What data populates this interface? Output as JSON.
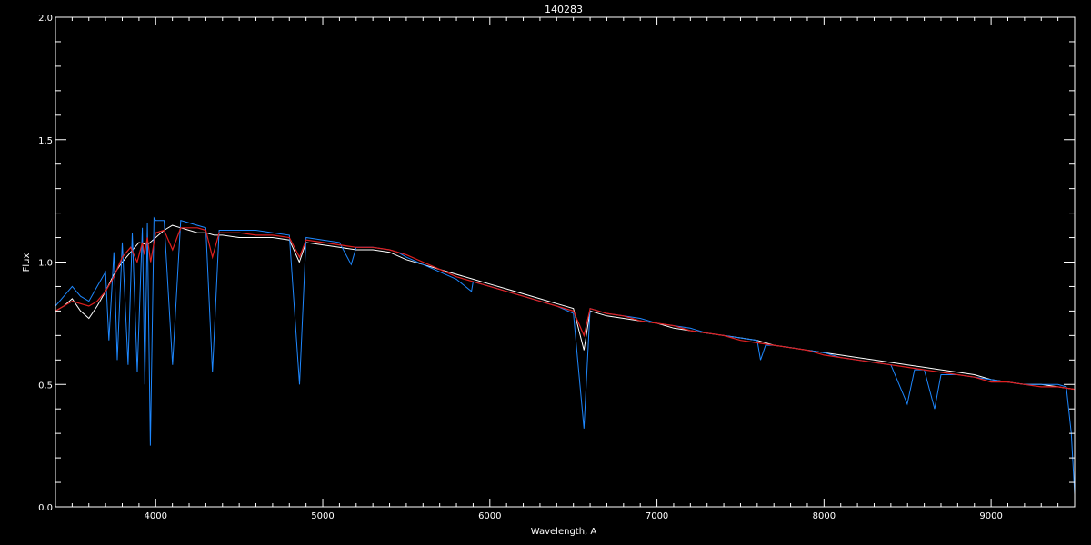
{
  "chart_data": {
    "type": "line",
    "title": "140283",
    "xlabel": "Wavelength, A",
    "ylabel": "Flux",
    "xlim": [
      3400,
      9500
    ],
    "ylim": [
      0.0,
      2.0
    ],
    "x_ticks": [
      4000,
      5000,
      6000,
      7000,
      8000,
      9000
    ],
    "x_tick_labels": [
      "4000",
      "5000",
      "6000",
      "7000",
      "8000",
      "9000"
    ],
    "y_ticks": [
      0.0,
      0.5,
      1.0,
      1.5,
      2.0
    ],
    "y_tick_labels": [
      "0.0",
      "0.5",
      "1.0",
      "1.5",
      "2.0"
    ],
    "grid": false,
    "background": "#000000",
    "axis_color": "#ffffff",
    "series": [
      {
        "color": "#ffffff",
        "x": [
          3400,
          3450,
          3500,
          3550,
          3600,
          3650,
          3700,
          3750,
          3800,
          3850,
          3900,
          3950,
          4000,
          4050,
          4100,
          4150,
          4200,
          4250,
          4300,
          4350,
          4400,
          4500,
          4600,
          4700,
          4800,
          4860,
          4900,
          5000,
          5100,
          5200,
          5300,
          5400,
          5500,
          5600,
          5700,
          5800,
          5900,
          6000,
          6100,
          6200,
          6300,
          6400,
          6500,
          6563,
          6600,
          6700,
          6800,
          6900,
          7000,
          7100,
          7200,
          7300,
          7400,
          7500,
          7600,
          7700,
          7800,
          7900,
          8000,
          8100,
          8200,
          8300,
          8400,
          8500,
          8600,
          8700,
          8800,
          8900,
          9000,
          9100,
          9200,
          9300,
          9400,
          9500
        ],
        "y": [
          0.8,
          0.82,
          0.85,
          0.8,
          0.77,
          0.82,
          0.88,
          0.95,
          1.0,
          1.04,
          1.08,
          1.07,
          1.1,
          1.13,
          1.15,
          1.14,
          1.13,
          1.12,
          1.12,
          1.11,
          1.11,
          1.1,
          1.1,
          1.1,
          1.09,
          1.0,
          1.08,
          1.07,
          1.06,
          1.05,
          1.05,
          1.04,
          1.01,
          0.99,
          0.97,
          0.95,
          0.93,
          0.91,
          0.89,
          0.87,
          0.85,
          0.83,
          0.81,
          0.64,
          0.8,
          0.78,
          0.77,
          0.76,
          0.75,
          0.73,
          0.72,
          0.71,
          0.7,
          0.69,
          0.68,
          0.66,
          0.65,
          0.64,
          0.63,
          0.62,
          0.61,
          0.6,
          0.59,
          0.58,
          0.57,
          0.56,
          0.55,
          0.54,
          0.52,
          0.51,
          0.5,
          0.5,
          0.49,
          0.48
        ]
      },
      {
        "color": "#1e88ff",
        "x": [
          3400,
          3450,
          3500,
          3550,
          3600,
          3650,
          3700,
          3720,
          3750,
          3770,
          3800,
          3835,
          3860,
          3890,
          3920,
          3935,
          3950,
          3968,
          3990,
          4000,
          4050,
          4101,
          4150,
          4200,
          4250,
          4300,
          4340,
          4380,
          4400,
          4500,
          4600,
          4700,
          4800,
          4861,
          4900,
          5000,
          5100,
          5170,
          5200,
          5250,
          5300,
          5400,
          5450,
          5500,
          5600,
          5700,
          5800,
          5890,
          5900,
          6000,
          6100,
          6200,
          6300,
          6400,
          6500,
          6563,
          6600,
          6700,
          6800,
          6900,
          7000,
          7100,
          7200,
          7300,
          7400,
          7500,
          7600,
          7620,
          7650,
          7700,
          7800,
          7900,
          8000,
          8100,
          8200,
          8300,
          8400,
          8498,
          8542,
          8600,
          8662,
          8700,
          8800,
          8900,
          9000,
          9100,
          9200,
          9300,
          9400,
          9450,
          9480,
          9500
        ],
        "y": [
          0.82,
          0.86,
          0.9,
          0.86,
          0.84,
          0.9,
          0.96,
          0.68,
          1.04,
          0.6,
          1.08,
          0.58,
          1.12,
          0.55,
          1.14,
          0.5,
          1.16,
          0.25,
          1.18,
          1.17,
          1.17,
          0.58,
          1.17,
          1.16,
          1.15,
          1.14,
          0.55,
          1.13,
          1.13,
          1.13,
          1.13,
          1.12,
          1.11,
          0.5,
          1.1,
          1.09,
          1.08,
          0.99,
          1.06,
          1.06,
          1.06,
          1.05,
          1.04,
          1.02,
          0.99,
          0.96,
          0.93,
          0.88,
          0.92,
          0.9,
          0.88,
          0.86,
          0.84,
          0.82,
          0.79,
          0.32,
          0.81,
          0.79,
          0.78,
          0.77,
          0.75,
          0.74,
          0.73,
          0.71,
          0.7,
          0.69,
          0.68,
          0.6,
          0.66,
          0.66,
          0.65,
          0.64,
          0.63,
          0.61,
          0.6,
          0.59,
          0.58,
          0.42,
          0.56,
          0.56,
          0.4,
          0.54,
          0.54,
          0.53,
          0.52,
          0.51,
          0.5,
          0.5,
          0.5,
          0.49,
          0.3,
          0.05
        ]
      },
      {
        "color": "#e02020",
        "x": [
          3400,
          3450,
          3500,
          3550,
          3600,
          3650,
          3700,
          3750,
          3800,
          3850,
          3889,
          3920,
          3933,
          3950,
          3970,
          4000,
          4050,
          4101,
          4150,
          4200,
          4250,
          4300,
          4340,
          4380,
          4400,
          4500,
          4600,
          4700,
          4800,
          4861,
          4900,
          5000,
          5100,
          5200,
          5300,
          5400,
          5500,
          5600,
          5700,
          5800,
          5900,
          6000,
          6100,
          6200,
          6300,
          6400,
          6500,
          6563,
          6600,
          6700,
          6800,
          6900,
          7000,
          7100,
          7200,
          7300,
          7400,
          7500,
          7600,
          7700,
          7800,
          7900,
          8000,
          8100,
          8200,
          8300,
          8400,
          8500,
          8600,
          8700,
          8800,
          8900,
          9000,
          9100,
          9200,
          9300,
          9400,
          9500
        ],
        "y": [
          0.8,
          0.82,
          0.84,
          0.83,
          0.82,
          0.84,
          0.88,
          0.94,
          1.02,
          1.06,
          1.0,
          1.08,
          1.03,
          1.1,
          1.0,
          1.12,
          1.13,
          1.05,
          1.14,
          1.14,
          1.14,
          1.13,
          1.02,
          1.12,
          1.12,
          1.12,
          1.11,
          1.11,
          1.1,
          1.02,
          1.09,
          1.08,
          1.07,
          1.06,
          1.06,
          1.05,
          1.03,
          1.0,
          0.97,
          0.94,
          0.92,
          0.9,
          0.88,
          0.86,
          0.84,
          0.82,
          0.8,
          0.7,
          0.81,
          0.79,
          0.78,
          0.76,
          0.75,
          0.74,
          0.72,
          0.71,
          0.7,
          0.68,
          0.67,
          0.66,
          0.65,
          0.64,
          0.62,
          0.61,
          0.6,
          0.59,
          0.58,
          0.57,
          0.56,
          0.55,
          0.54,
          0.53,
          0.51,
          0.51,
          0.5,
          0.49,
          0.49,
          0.48
        ]
      }
    ]
  }
}
